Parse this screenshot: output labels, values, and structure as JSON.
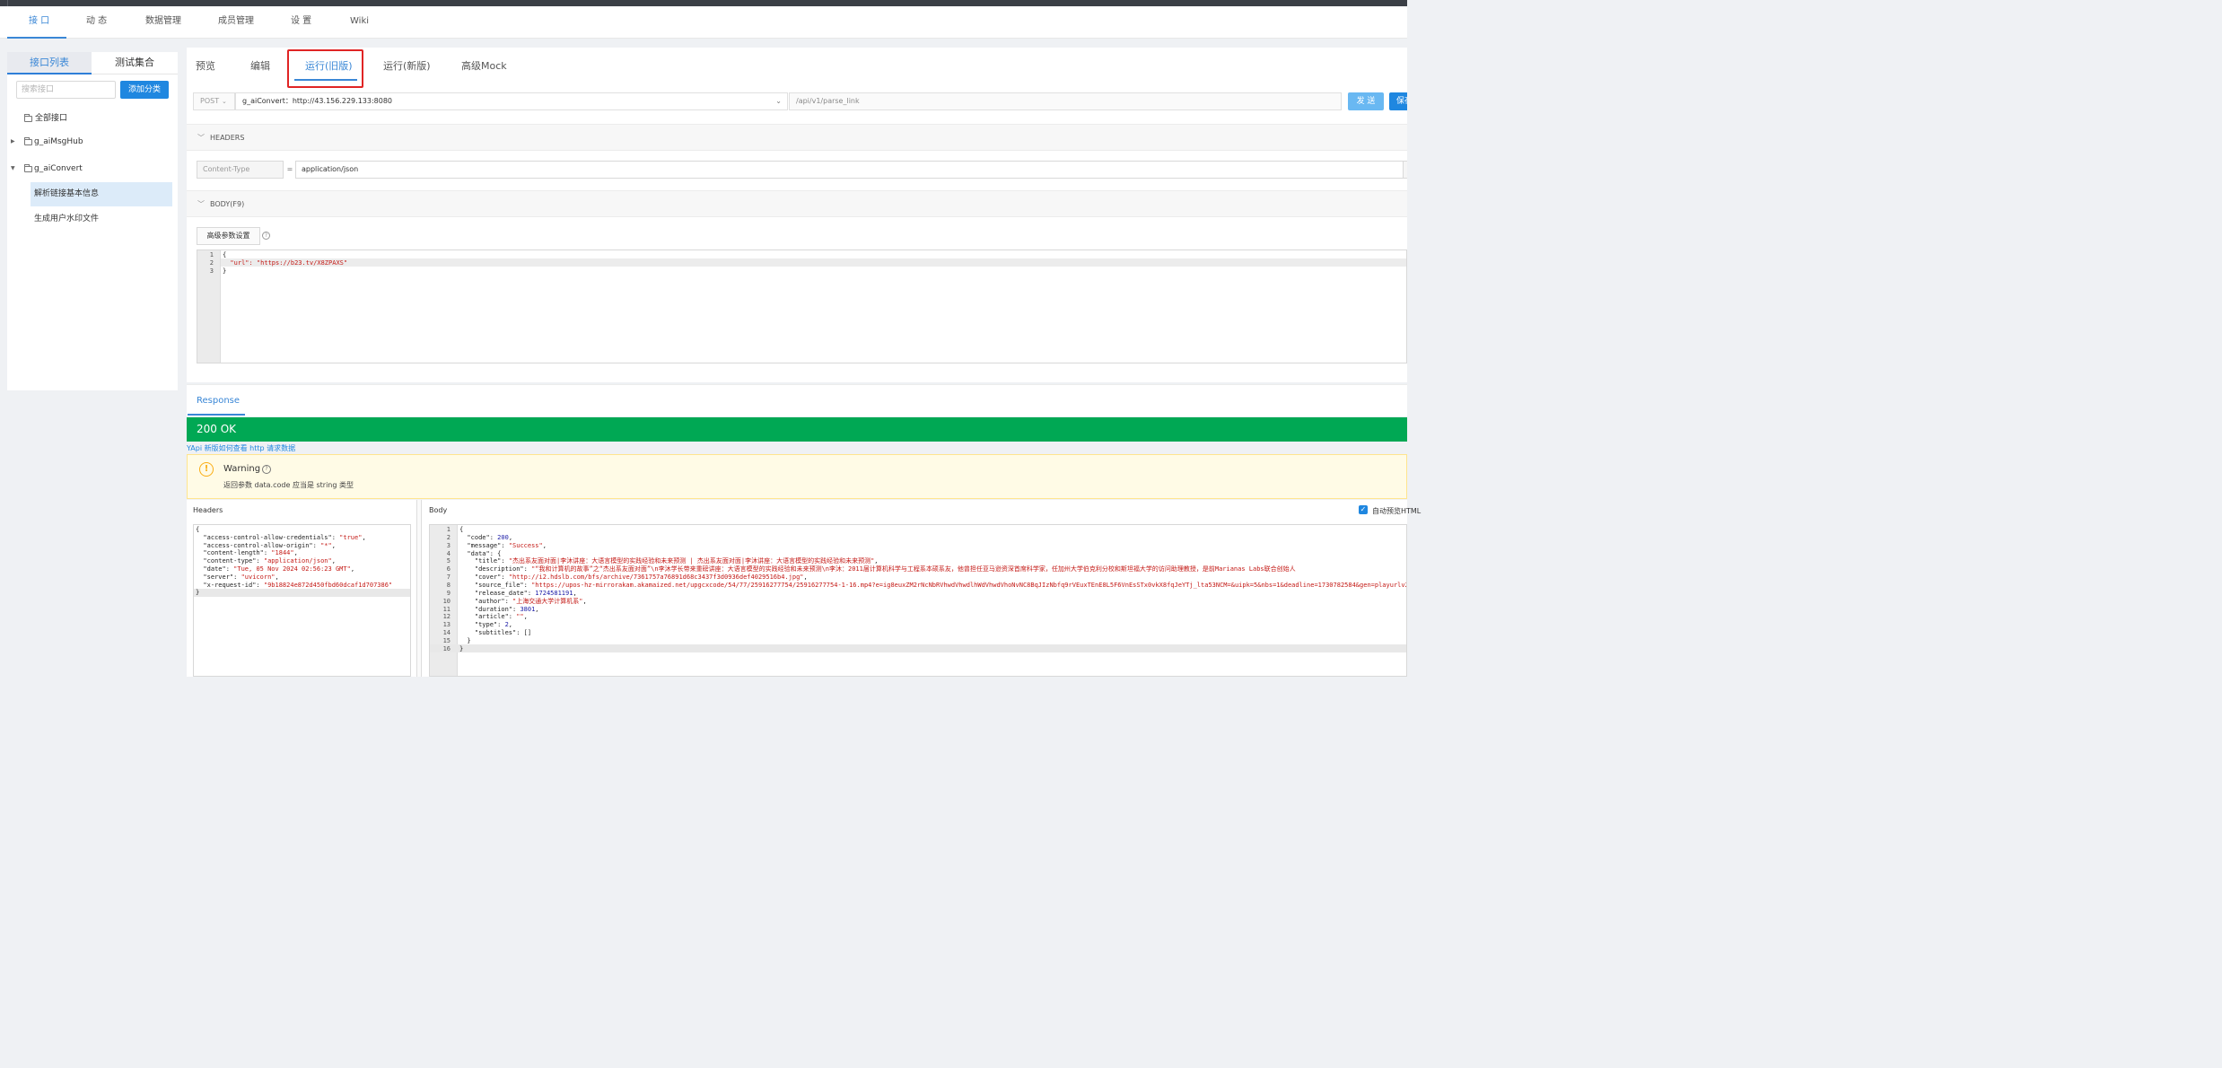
{
  "nav": {
    "tabs": [
      "接 口",
      "动 态",
      "数据管理",
      "成员管理",
      "设 置",
      "Wiki"
    ],
    "active_index": 0
  },
  "sidebar": {
    "tabs": [
      "接口列表",
      "测试集合"
    ],
    "search_placeholder": "搜索接口",
    "add_category_label": "添加分类",
    "tree": {
      "all_label": "全部接口",
      "folders": [
        {
          "label": "g_aiMsgHub",
          "expanded": false,
          "items": []
        },
        {
          "label": "g_aiConvert",
          "expanded": true,
          "items": [
            "解析链接基本信息",
            "生成用户水印文件"
          ]
        }
      ],
      "selected_item": "解析链接基本信息"
    }
  },
  "api_tabs": [
    "预览",
    "编辑",
    "运行(旧版)",
    "运行(新版)",
    "高级Mock"
  ],
  "active_api_tab": "运行(旧版)",
  "request": {
    "method": "POST",
    "env": "g_aiConvert：http://43.156.229.133:8080",
    "path": "/api/v1/parse_link",
    "send_label": "发 送",
    "save_label": "保存"
  },
  "headers_section": {
    "title": "HEADERS",
    "key": "Content-Type",
    "eq": "=",
    "value": "application/json"
  },
  "body_section": {
    "title": "BODY(F9)",
    "advanced_label": "高级参数设置",
    "code_lines": [
      [
        {
          "t": "{",
          "c": "p"
        }
      ],
      [
        {
          "t": "  \"url\": ",
          "c": "s"
        },
        {
          "t": "\"https://b23.tv/X8ZPAXS\"",
          "c": "s"
        }
      ],
      [
        {
          "t": "}",
          "c": "p"
        }
      ]
    ]
  },
  "response": {
    "tab_label": "Response",
    "status": "200 OK",
    "help_link": "YApi 新版如何查看 http 请求数据",
    "warning_title": "Warning",
    "warning_text": "返回参数 data.code 应当是 string 类型",
    "headers_label": "Headers",
    "body_label": "Body",
    "autopreview_label": "自动预览HTML",
    "headers_lines": [
      [
        {
          "t": "{",
          "c": "p"
        }
      ],
      [
        {
          "t": "  \"access-control-allow-credentials\": ",
          "c": "k"
        },
        {
          "t": "\"true\"",
          "c": "s"
        },
        {
          "t": ",",
          "c": "p"
        }
      ],
      [
        {
          "t": "  \"access-control-allow-origin\": ",
          "c": "k"
        },
        {
          "t": "\"*\"",
          "c": "s"
        },
        {
          "t": ",",
          "c": "p"
        }
      ],
      [
        {
          "t": "  \"content-length\": ",
          "c": "k"
        },
        {
          "t": "\"1844\"",
          "c": "s"
        },
        {
          "t": ",",
          "c": "p"
        }
      ],
      [
        {
          "t": "  \"content-type\": ",
          "c": "k"
        },
        {
          "t": "\"application/json\"",
          "c": "s"
        },
        {
          "t": ",",
          "c": "p"
        }
      ],
      [
        {
          "t": "  \"date\": ",
          "c": "k"
        },
        {
          "t": "\"Tue, 05 Nov 2024 02:56:23 GMT\"",
          "c": "s"
        },
        {
          "t": ",",
          "c": "p"
        }
      ],
      [
        {
          "t": "  \"server\": ",
          "c": "k"
        },
        {
          "t": "\"uvicorn\"",
          "c": "s"
        },
        {
          "t": ",",
          "c": "p"
        }
      ],
      [
        {
          "t": "  \"x-request-id\": ",
          "c": "k"
        },
        {
          "t": "\"9b18824e872d450fbd60dcaf1d707386\"",
          "c": "s"
        }
      ],
      [
        {
          "t": "}",
          "c": "p"
        }
      ]
    ],
    "body_lines": [
      [
        {
          "t": "{",
          "c": "p"
        }
      ],
      [
        {
          "t": "  \"code\": ",
          "c": "k"
        },
        {
          "t": "200",
          "c": "n"
        },
        {
          "t": ",",
          "c": "p"
        }
      ],
      [
        {
          "t": "  \"message\": ",
          "c": "k"
        },
        {
          "t": "\"Success\"",
          "c": "s"
        },
        {
          "t": ",",
          "c": "p"
        }
      ],
      [
        {
          "t": "  \"data\": {",
          "c": "k"
        }
      ],
      [
        {
          "t": "    \"title\": ",
          "c": "k"
        },
        {
          "t": "\"杰出系友面对面|李沐讲座：大语言模型的实践经验和未来预测 | 杰出系友面对面|李沐讲座：大语言模型的实践经验和未来预测\"",
          "c": "s"
        },
        {
          "t": ",",
          "c": "p"
        }
      ],
      [
        {
          "t": "    \"description\": ",
          "c": "k"
        },
        {
          "t": "\"“我和计算机的故事”之“杰出系友面对面”\\n李沐学长带来重磅讲座：大语言模型的实践经验和未来预测\\n李沐：2011届计算机科学与工程系本硕系友，他曾担任亚马逊资深首席科学家，任加州大学伯克利分校和斯坦福大学的访问助理教授，是前Marianas Labs联合创始人",
          "c": "s"
        }
      ],
      [
        {
          "t": "    \"cover\": ",
          "c": "k"
        },
        {
          "t": "\"http://i2.hdslb.com/bfs/archive/7361757a76891d68c3437f3d0936def4029516b4.jpg\"",
          "c": "s"
        },
        {
          "t": ",",
          "c": "p"
        }
      ],
      [
        {
          "t": "    \"source_file\": ",
          "c": "k"
        },
        {
          "t": "\"https://upos-hz-mirrorakam.akamaized.net/upgcxcode/54/77/25916277754/25916277754-1-16.mp4?e=ig8euxZM2rNcNbRVhwdVhwdlhWdVhwdVhoNvNC8BqJIzNbfq9rVEuxTEnE8L5F6VnEsSTx0vkX8fqJeYTj_lta53NCM=&uipk=5&nbs=1&deadline=1730782584&gen=playurlv2&os",
          "c": "s"
        }
      ],
      [
        {
          "t": "    \"release_date\": ",
          "c": "k"
        },
        {
          "t": "1724581191",
          "c": "n"
        },
        {
          "t": ",",
          "c": "p"
        }
      ],
      [
        {
          "t": "    \"author\": ",
          "c": "k"
        },
        {
          "t": "\"上海交通大学计算机系\"",
          "c": "s"
        },
        {
          "t": ",",
          "c": "p"
        }
      ],
      [
        {
          "t": "    \"duration\": ",
          "c": "k"
        },
        {
          "t": "3801",
          "c": "n"
        },
        {
          "t": ",",
          "c": "p"
        }
      ],
      [
        {
          "t": "    \"article\": ",
          "c": "k"
        },
        {
          "t": "\"\"",
          "c": "s"
        },
        {
          "t": ",",
          "c": "p"
        }
      ],
      [
        {
          "t": "    \"type\": ",
          "c": "k"
        },
        {
          "t": "2",
          "c": "n"
        },
        {
          "t": ",",
          "c": "p"
        }
      ],
      [
        {
          "t": "    \"subtitles\": []",
          "c": "k"
        }
      ],
      [
        {
          "t": "  }",
          "c": "p"
        }
      ],
      [
        {
          "t": "}",
          "c": "p"
        }
      ]
    ]
  },
  "colors": {
    "accent": "#1f87e0",
    "status_ok": "#00a854",
    "highlight_border": "#e02424",
    "warning_bg": "#fffbe6"
  },
  "icons": [
    "folder-icon",
    "caret-right-icon",
    "caret-down-icon",
    "chevron-down-icon",
    "help-icon",
    "warning-icon",
    "checkbox-checked-icon"
  ]
}
